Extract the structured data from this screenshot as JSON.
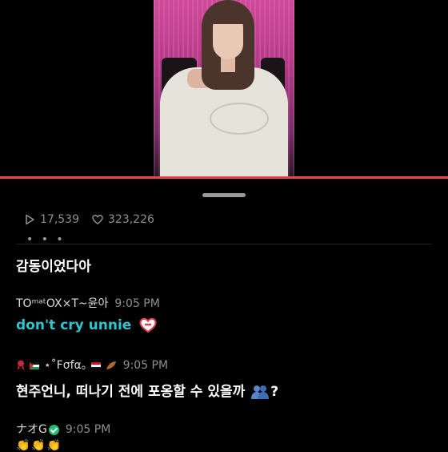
{
  "stats": {
    "views": "17,539",
    "likes": "323,226",
    "views_icon": "play-icon",
    "likes_icon": "heart-icon"
  },
  "more_label": "• • •",
  "comments": [
    {
      "text": "감동이었다아"
    },
    {
      "username": "TOᵐᵃᵗOX×T~윤아",
      "time": "9:05 PM",
      "text": "don't cry unnie"
    },
    {
      "username": "⋆˚Fσfα｡",
      "time": "9:05 PM",
      "text": "현주언니, 떠나기 전에 포옹할 수 있을까",
      "text_suffix": "?"
    },
    {
      "username": "ナオG",
      "time": "9:05 PM"
    }
  ],
  "colors": {
    "progress": "#e8474f",
    "highlight_text": "#2ec5d3",
    "verified": "#1fbf73"
  }
}
